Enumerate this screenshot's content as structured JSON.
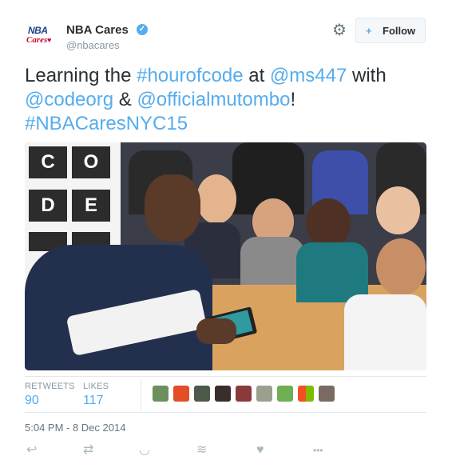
{
  "account": {
    "display_name": "NBA Cares",
    "handle": "@nbacares",
    "verified_icon": "✓",
    "logo_top": "NBA",
    "logo_bottom": "Cares"
  },
  "header": {
    "gear_icon": "⚙",
    "follow_icon": "+",
    "follow_label": "Follow"
  },
  "tweet": {
    "text_parts": [
      {
        "text": "Learning the ",
        "link": false
      },
      {
        "text": "#hourofcode",
        "link": true
      },
      {
        "text": " at ",
        "link": false
      },
      {
        "text": "@ms447",
        "link": true
      },
      {
        "text": " with ",
        "link": false
      },
      {
        "text": "@codeorg",
        "link": true
      },
      {
        "text": " & ",
        "link": false
      },
      {
        "text": "@officialmutombo",
        "link": true
      },
      {
        "text": "! ",
        "link": false
      },
      {
        "text": "#NBACaresNYC15",
        "link": true
      }
    ],
    "photo_letters": [
      "C",
      "O",
      "D",
      "E"
    ]
  },
  "stats": {
    "retweets_label": "RETWEETS",
    "retweets_value": "90",
    "likes_label": "LIKES",
    "likes_value": "117"
  },
  "timestamp": "5:04 PM - 8 Dec 2014",
  "actions": {
    "reply_icon": "↩",
    "retweet_icon": "⇄",
    "bookmark_icon": "◡",
    "stack_icon": "≋",
    "like_icon": "♥",
    "more_icon": "•••"
  },
  "colors": {
    "link": "#55acee",
    "text": "#292f33",
    "muted": "#8899a6"
  }
}
